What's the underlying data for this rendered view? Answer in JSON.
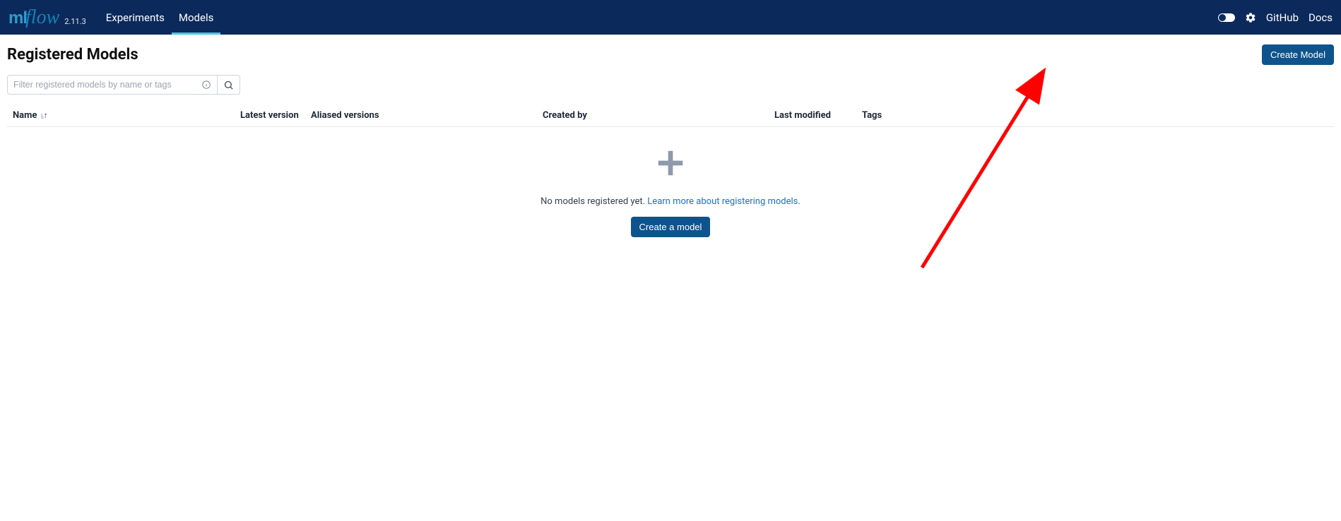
{
  "app": {
    "logo_ml": "ml",
    "logo_flow": "flow",
    "version": "2.11.3"
  },
  "nav": {
    "tabs": [
      {
        "label": "Experiments",
        "active": false
      },
      {
        "label": "Models",
        "active": true
      }
    ],
    "github": "GitHub",
    "docs": "Docs"
  },
  "page": {
    "title": "Registered Models",
    "create_button": "Create Model"
  },
  "search": {
    "placeholder": "Filter registered models by name or tags"
  },
  "table": {
    "columns": {
      "name": "Name",
      "latest_version": "Latest version",
      "aliased_versions": "Aliased versions",
      "created_by": "Created by",
      "last_modified": "Last modified",
      "tags": "Tags"
    }
  },
  "empty": {
    "text_before": "No models registered yet. ",
    "link": "Learn more about registering models",
    "text_after": ".",
    "create_button": "Create a model"
  }
}
